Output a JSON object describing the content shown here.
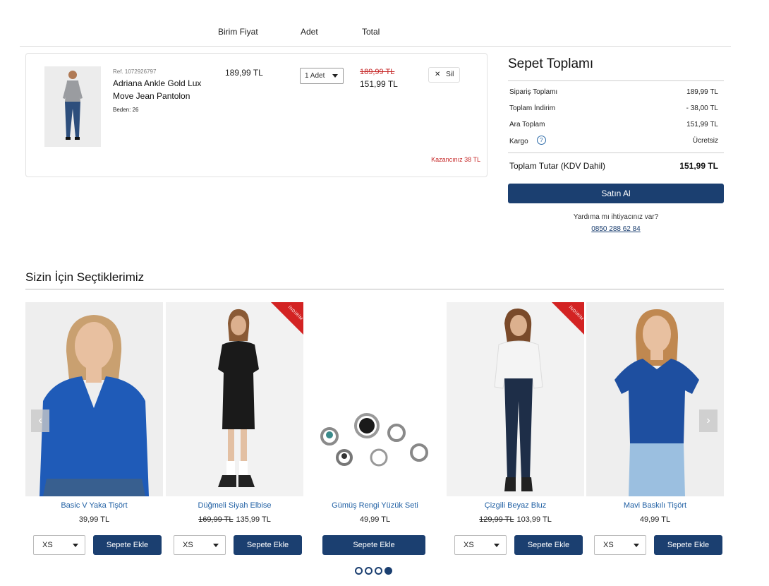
{
  "cart_headers": {
    "unit_price": "Birim Fiyat",
    "quantity": "Adet",
    "total": "Total"
  },
  "cart_item": {
    "ref": "Ref. 1072926797",
    "name": "Adriana Ankle Gold Lux Move Jean Pantolon",
    "size": "Beden: 26",
    "unit_price": "189,99 TL",
    "quantity": "1 Adet",
    "old_total": "189,99 TL",
    "new_total": "151,99 TL",
    "remove_label": "Sil",
    "savings": "Kazancınız 38 TL"
  },
  "summary": {
    "title": "Sepet Toplamı",
    "rows": [
      {
        "label": "Sipariş Toplamı",
        "value": "189,99 TL"
      },
      {
        "label": "Toplam İndirim",
        "value": "- 38,00 TL"
      },
      {
        "label": "Ara Toplam",
        "value": "151,99 TL"
      },
      {
        "label": "Kargo",
        "value": "Ücretsiz"
      }
    ],
    "total_label": "Toplam Tutar (KDV Dahil)",
    "total_value": "151,99 TL",
    "buy_label": "Satın Al",
    "help_text": "Yardıma mı ihtiyacınız var?",
    "help_phone": "0850 288 62 84",
    "help_icon": "?"
  },
  "recommendations": {
    "title": "Sizin İçin Seçtiklerimiz",
    "ribbon_label": "İNDİRİM",
    "add_label": "Sepete Ekle",
    "products": [
      {
        "name": "Basic V Yaka Tişört",
        "price": "39,99 TL",
        "old_price": "",
        "size": "XS"
      },
      {
        "name": "Düğmeli Siyah Elbise",
        "price": "135,99 TL",
        "old_price": "169,99 TL",
        "size": "XS"
      },
      {
        "name": "Gümüş Rengi Yüzük Seti",
        "price": "49,99 TL",
        "old_price": "",
        "size": ""
      },
      {
        "name": "Çizgili Beyaz Bluz",
        "price": "103,99 TL",
        "old_price": "129,99 TL",
        "size": "XS"
      },
      {
        "name": "Mavi Baskılı Tişört",
        "price": "49,99 TL",
        "old_price": "",
        "size": "XS"
      }
    ],
    "prev_arrow": "‹",
    "next_arrow": "›"
  },
  "colors": {
    "brand": "#1b3f70",
    "link": "#1f5fa3",
    "sale": "#c62828"
  },
  "icons": {
    "remove": "close-icon",
    "caret": "chevron-down-icon",
    "help": "help-circle-icon"
  }
}
